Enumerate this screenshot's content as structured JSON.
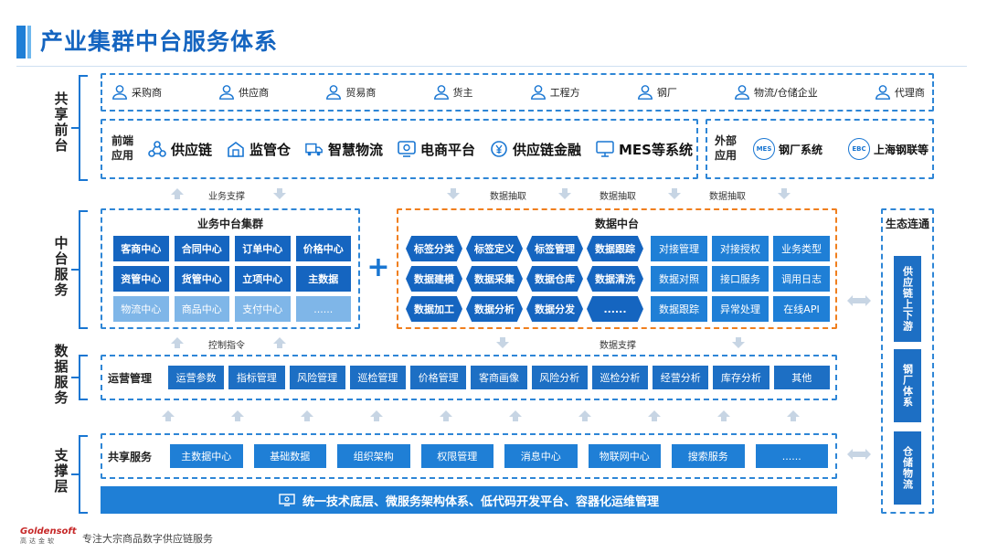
{
  "title": "产业集群中台服务体系",
  "layers": {
    "front": "共享前台",
    "middle": "中台服务",
    "data": "数据服务",
    "support": "支撑层"
  },
  "roles": [
    "采购商",
    "供应商",
    "贸易商",
    "货主",
    "工程方",
    "钢厂",
    "物流/仓储企业",
    "代理商"
  ],
  "front_apps": {
    "label": "前端应用",
    "items": [
      {
        "icon": "supply-chain-icon",
        "text": "供应链"
      },
      {
        "icon": "warehouse-icon",
        "text": "监管仓"
      },
      {
        "icon": "truck-icon",
        "text": "智慧物流"
      },
      {
        "icon": "ecommerce-icon",
        "text": "电商平台"
      },
      {
        "icon": "finance-icon",
        "text": "供应链金融"
      },
      {
        "icon": "mes-icon",
        "text": "MES等系统"
      }
    ]
  },
  "external_apps": {
    "label": "外部应用",
    "items": [
      {
        "badge": "MES",
        "text": "钢厂系统"
      },
      {
        "badge": "EBC",
        "text": "上海钢联等"
      }
    ]
  },
  "flow_labels": {
    "business_support": "业务支撑",
    "data_extract_1": "数据抽取",
    "data_extract_2": "数据抽取",
    "data_extract_3": "数据抽取",
    "control_cmd": "控制指令",
    "data_support": "数据支撑"
  },
  "business_center": {
    "title": "业务中台集群",
    "rows": [
      [
        "客商中心",
        "合同中心",
        "订单中心",
        "价格中心"
      ],
      [
        "资管中心",
        "货管中心",
        "立项中心",
        "主数据"
      ],
      [
        "物流中心",
        "商品中心",
        "支付中心",
        "......"
      ]
    ]
  },
  "plus": "+",
  "data_center": {
    "title": "数据中台",
    "hex_rows": [
      [
        "标签分类",
        "标签定义",
        "标签管理",
        "数据跟踪"
      ],
      [
        "数据建模",
        "数据采集",
        "数据仓库",
        "数据清洗"
      ],
      [
        "数据加工",
        "数据分析",
        "数据分发",
        "......"
      ]
    ],
    "rect_rows": [
      [
        "对接管理",
        "对接授权",
        "业务类型"
      ],
      [
        "数据对照",
        "接口服务",
        "调用日志"
      ],
      [
        "数据跟踪",
        "异常处理",
        "在线API"
      ]
    ]
  },
  "ecosystem": {
    "title": "生态连通",
    "items": [
      "供应链上下游",
      "钢厂体系",
      "仓储物流"
    ]
  },
  "operations": {
    "label": "运营管理",
    "items": [
      "运营参数",
      "指标管理",
      "风险管理",
      "巡检管理",
      "价格管理",
      "客商画像",
      "风险分析",
      "巡检分析",
      "经营分析",
      "库存分析",
      "其他"
    ]
  },
  "shared_services": {
    "label": "共享服务",
    "items": [
      "主数据中心",
      "基础数据",
      "组织架构",
      "权限管理",
      "消息中心",
      "物联网中心",
      "搜索服务",
      "......"
    ]
  },
  "foundation": "统一技术底层、微服务架构体系、低代码开发平台、容器化运维管理",
  "footer": {
    "logo": "Goldensoft",
    "logo_sub": "高达金软",
    "tagline": "专注大宗商品数字供应链服务"
  },
  "colors": {
    "primary": "#1565c0",
    "accent": "#1f7fd6",
    "orange": "#f07f1e",
    "light": "#7fb6e8"
  }
}
